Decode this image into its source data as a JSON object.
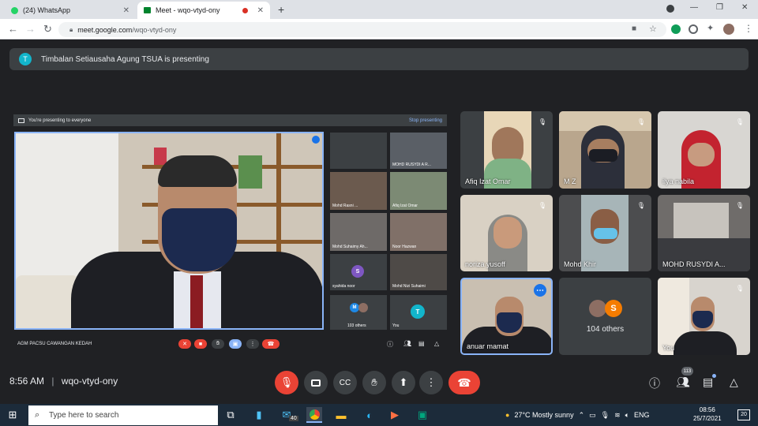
{
  "browser": {
    "tabs": [
      {
        "label": "(24) WhatsApp",
        "active": false
      },
      {
        "label": "Meet - wqo-vtyd-ony",
        "active": true
      }
    ],
    "new_tab": "+",
    "url_host": "meet.google.com",
    "url_path": "/wqo-vtyd-ony",
    "window_controls": [
      "—",
      "❐",
      "✕"
    ]
  },
  "banner": {
    "badge": "T",
    "text": "Timbalan Setiausaha Agung TSUA is presenting"
  },
  "presentation": {
    "bar_left": "You're presenting to everyone",
    "bar_right": "Stop presenting",
    "speaker_label": "AGM PACSU CAWANGAN KEDAH",
    "mini_tiles": [
      {
        "name": ""
      },
      {
        "name": "MOHD RUSYDI A R..."
      },
      {
        "name": "Mohd Rasni ... "
      },
      {
        "name": "Afiq Izat Omar"
      },
      {
        "name": "Mohd Suhaimy Ah..."
      },
      {
        "name": "Noor Hazwan"
      },
      {
        "name": "syahida noor",
        "avatar": "S"
      },
      {
        "name": "Mohd Nizi Suhaimi"
      },
      {
        "name": "103 others",
        "avatar": "M"
      },
      {
        "name": "You",
        "avatar": "T"
      }
    ]
  },
  "grid": [
    {
      "name": "Afiq Izat Omar"
    },
    {
      "name": "M Z"
    },
    {
      "name": "ilya nabila"
    },
    {
      "name": "noriza yusoff"
    },
    {
      "name": "Mohd Khir"
    },
    {
      "name": "MOHD RUSYDI A..."
    },
    {
      "name": "anuar mamat"
    },
    {
      "name": "104 others",
      "avatar": "S"
    },
    {
      "name": "You"
    }
  ],
  "meeting": {
    "time": "8:56 AM",
    "separator": "|",
    "code": "wqo-vtyd-ony",
    "people_count": "113"
  },
  "colors": {
    "accent": "#8ab4f8",
    "end_red": "#ea4335",
    "tile_bg": "#3c4043"
  },
  "taskbar": {
    "search_placeholder": "Type here to search",
    "mail_badge": "40",
    "weather": "27°C  Mostly sunny",
    "lang": "ENG",
    "time": "08:56",
    "date": "25/7/2021",
    "notif": "20"
  }
}
